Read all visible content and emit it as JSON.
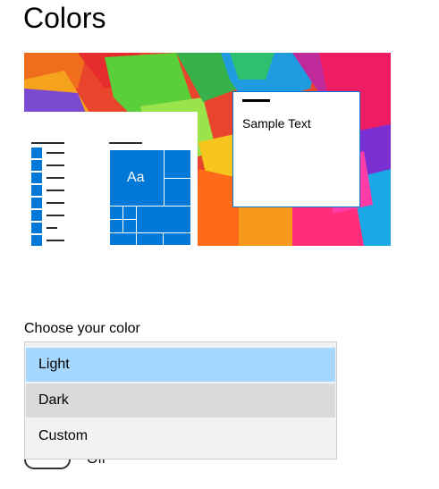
{
  "page": {
    "title": "Colors"
  },
  "preview": {
    "sample_text": "Sample Text",
    "tile_text": "Aa",
    "accent_color": "#0078d7"
  },
  "color_mode": {
    "label": "Choose your color",
    "options": [
      {
        "label": "Light",
        "selected": true
      },
      {
        "label": "Dark",
        "selected": false
      },
      {
        "label": "Custom",
        "selected": false
      }
    ]
  },
  "toggle": {
    "state_text": "Off"
  }
}
